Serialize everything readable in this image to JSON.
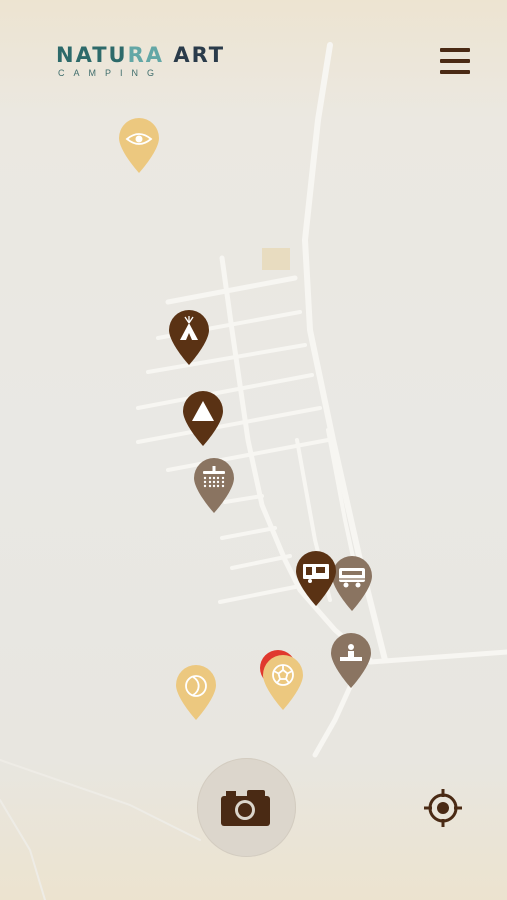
{
  "brand": {
    "title_part1": "NATU",
    "title_part2": "RA",
    "title_part3": " ART",
    "subtitle": "CAMPING"
  },
  "colors": {
    "pin_dark": "#5a3214",
    "pin_medium": "#8a7461",
    "pin_light": "#ecc87f",
    "pin_alert": "#e0392e",
    "road": "#f7f6f2",
    "icon_dark": "#4a2a14"
  },
  "pins": [
    {
      "icon": "eye-icon",
      "color": "pin_light"
    },
    {
      "icon": "tipi-icon",
      "color": "pin_dark"
    },
    {
      "icon": "tent-icon",
      "color": "pin_dark"
    },
    {
      "icon": "shower-icon",
      "color": "pin_medium"
    },
    {
      "icon": "bungalow-icon",
      "color": "pin_dark"
    },
    {
      "icon": "caravan-icon",
      "color": "pin_medium"
    },
    {
      "icon": "reception-icon",
      "color": "pin_medium"
    },
    {
      "icon": "football-icon",
      "color": "pin_light"
    },
    {
      "icon": "moon-icon",
      "color": "pin_light"
    }
  ],
  "controls": {
    "menu_icon": "hamburger-menu-icon",
    "camera_icon": "camera-icon",
    "locate_icon": "crosshair-icon"
  }
}
